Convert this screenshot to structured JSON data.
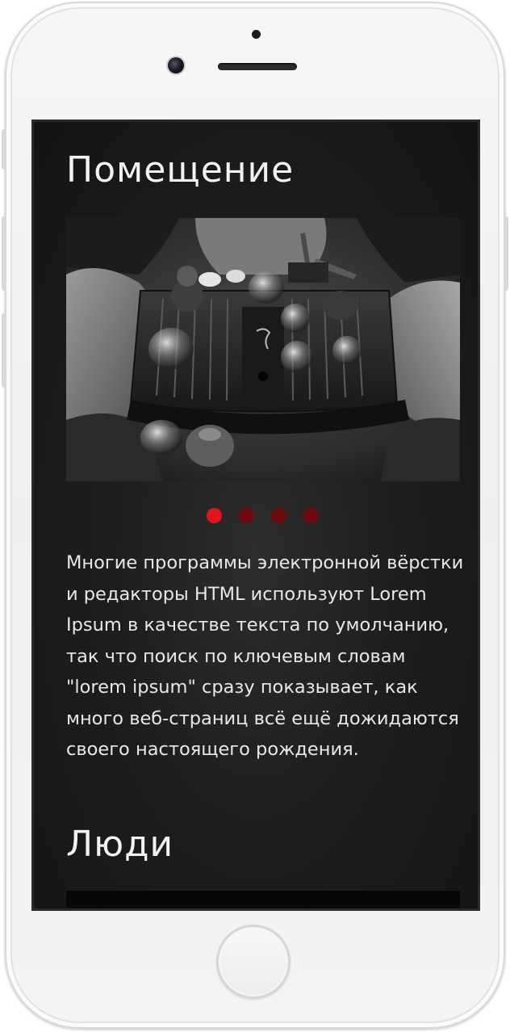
{
  "content": {
    "section_1_title": "Помещение",
    "section_2_title": "Люди",
    "description": "Многие программы электронной вёрстки и редакторы HTML используют Lorem Ipsum в качестве текста по умолчанию, так что поиск по ключевым словам \"lorem ipsum\" сразу показывает, как много веб-страниц всё ещё дожидаются своего настоящего рождения."
  },
  "slider": {
    "slide_count": 4,
    "active_slide": 1
  },
  "colors": {
    "dot_active": "#e0141a",
    "dot_inactive": "#6e0b0b",
    "background": "#1e1e1e",
    "text": "#e8e8e8"
  },
  "icons": {
    "device": "phone-frame",
    "home": "home-button"
  }
}
